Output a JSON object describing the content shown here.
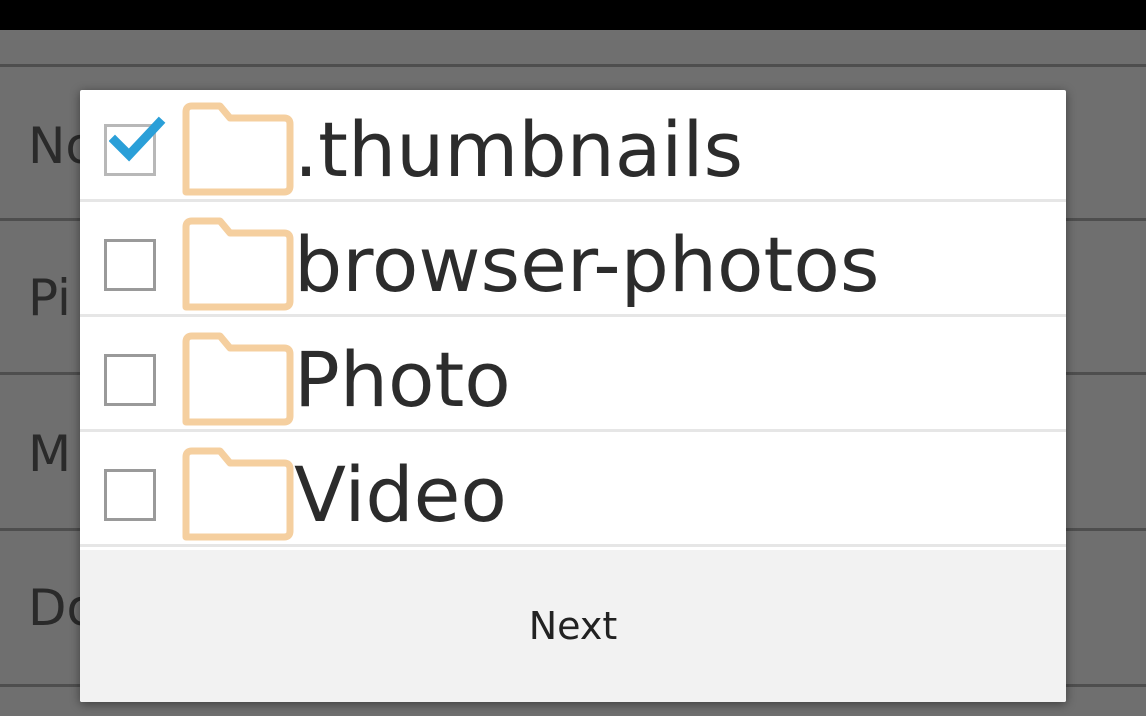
{
  "background_list": {
    "items": [
      {
        "label": "No"
      },
      {
        "label": "Pi"
      },
      {
        "label": "M"
      },
      {
        "label": "Do"
      }
    ]
  },
  "dialog": {
    "folders": [
      {
        "name": ".thumbnails",
        "checked": true,
        "icon": "folder-icon"
      },
      {
        "name": "browser-photos",
        "checked": false,
        "icon": "folder-icon"
      },
      {
        "name": "Photo",
        "checked": false,
        "icon": "folder-icon"
      },
      {
        "name": "Video",
        "checked": false,
        "icon": "folder-icon"
      }
    ],
    "next_label": "Next"
  },
  "colors": {
    "checkmark": "#2a9fd8",
    "folder_outline": "#f5cf9f",
    "overlay_background": "#6f6f6f"
  }
}
